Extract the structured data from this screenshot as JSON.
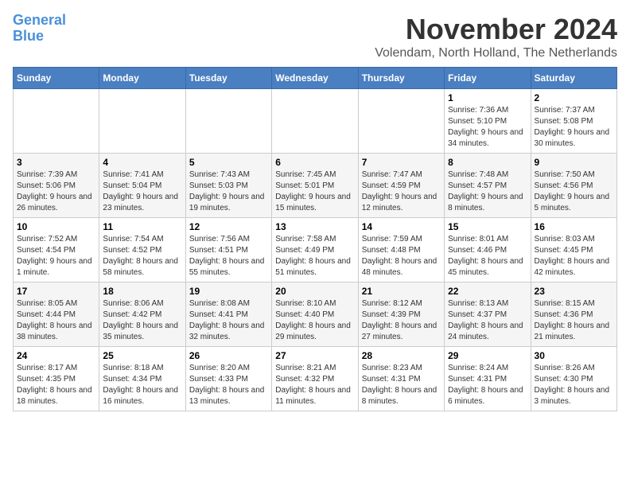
{
  "logo": {
    "line1": "General",
    "line2": "Blue"
  },
  "title": "November 2024",
  "location": "Volendam, North Holland, The Netherlands",
  "days_of_week": [
    "Sunday",
    "Monday",
    "Tuesday",
    "Wednesday",
    "Thursday",
    "Friday",
    "Saturday"
  ],
  "weeks": [
    [
      {
        "day": "",
        "info": ""
      },
      {
        "day": "",
        "info": ""
      },
      {
        "day": "",
        "info": ""
      },
      {
        "day": "",
        "info": ""
      },
      {
        "day": "",
        "info": ""
      },
      {
        "day": "1",
        "info": "Sunrise: 7:36 AM\nSunset: 5:10 PM\nDaylight: 9 hours and 34 minutes."
      },
      {
        "day": "2",
        "info": "Sunrise: 7:37 AM\nSunset: 5:08 PM\nDaylight: 9 hours and 30 minutes."
      }
    ],
    [
      {
        "day": "3",
        "info": "Sunrise: 7:39 AM\nSunset: 5:06 PM\nDaylight: 9 hours and 26 minutes."
      },
      {
        "day": "4",
        "info": "Sunrise: 7:41 AM\nSunset: 5:04 PM\nDaylight: 9 hours and 23 minutes."
      },
      {
        "day": "5",
        "info": "Sunrise: 7:43 AM\nSunset: 5:03 PM\nDaylight: 9 hours and 19 minutes."
      },
      {
        "day": "6",
        "info": "Sunrise: 7:45 AM\nSunset: 5:01 PM\nDaylight: 9 hours and 15 minutes."
      },
      {
        "day": "7",
        "info": "Sunrise: 7:47 AM\nSunset: 4:59 PM\nDaylight: 9 hours and 12 minutes."
      },
      {
        "day": "8",
        "info": "Sunrise: 7:48 AM\nSunset: 4:57 PM\nDaylight: 9 hours and 8 minutes."
      },
      {
        "day": "9",
        "info": "Sunrise: 7:50 AM\nSunset: 4:56 PM\nDaylight: 9 hours and 5 minutes."
      }
    ],
    [
      {
        "day": "10",
        "info": "Sunrise: 7:52 AM\nSunset: 4:54 PM\nDaylight: 9 hours and 1 minute."
      },
      {
        "day": "11",
        "info": "Sunrise: 7:54 AM\nSunset: 4:52 PM\nDaylight: 8 hours and 58 minutes."
      },
      {
        "day": "12",
        "info": "Sunrise: 7:56 AM\nSunset: 4:51 PM\nDaylight: 8 hours and 55 minutes."
      },
      {
        "day": "13",
        "info": "Sunrise: 7:58 AM\nSunset: 4:49 PM\nDaylight: 8 hours and 51 minutes."
      },
      {
        "day": "14",
        "info": "Sunrise: 7:59 AM\nSunset: 4:48 PM\nDaylight: 8 hours and 48 minutes."
      },
      {
        "day": "15",
        "info": "Sunrise: 8:01 AM\nSunset: 4:46 PM\nDaylight: 8 hours and 45 minutes."
      },
      {
        "day": "16",
        "info": "Sunrise: 8:03 AM\nSunset: 4:45 PM\nDaylight: 8 hours and 42 minutes."
      }
    ],
    [
      {
        "day": "17",
        "info": "Sunrise: 8:05 AM\nSunset: 4:44 PM\nDaylight: 8 hours and 38 minutes."
      },
      {
        "day": "18",
        "info": "Sunrise: 8:06 AM\nSunset: 4:42 PM\nDaylight: 8 hours and 35 minutes."
      },
      {
        "day": "19",
        "info": "Sunrise: 8:08 AM\nSunset: 4:41 PM\nDaylight: 8 hours and 32 minutes."
      },
      {
        "day": "20",
        "info": "Sunrise: 8:10 AM\nSunset: 4:40 PM\nDaylight: 8 hours and 29 minutes."
      },
      {
        "day": "21",
        "info": "Sunrise: 8:12 AM\nSunset: 4:39 PM\nDaylight: 8 hours and 27 minutes."
      },
      {
        "day": "22",
        "info": "Sunrise: 8:13 AM\nSunset: 4:37 PM\nDaylight: 8 hours and 24 minutes."
      },
      {
        "day": "23",
        "info": "Sunrise: 8:15 AM\nSunset: 4:36 PM\nDaylight: 8 hours and 21 minutes."
      }
    ],
    [
      {
        "day": "24",
        "info": "Sunrise: 8:17 AM\nSunset: 4:35 PM\nDaylight: 8 hours and 18 minutes."
      },
      {
        "day": "25",
        "info": "Sunrise: 8:18 AM\nSunset: 4:34 PM\nDaylight: 8 hours and 16 minutes."
      },
      {
        "day": "26",
        "info": "Sunrise: 8:20 AM\nSunset: 4:33 PM\nDaylight: 8 hours and 13 minutes."
      },
      {
        "day": "27",
        "info": "Sunrise: 8:21 AM\nSunset: 4:32 PM\nDaylight: 8 hours and 11 minutes."
      },
      {
        "day": "28",
        "info": "Sunrise: 8:23 AM\nSunset: 4:31 PM\nDaylight: 8 hours and 8 minutes."
      },
      {
        "day": "29",
        "info": "Sunrise: 8:24 AM\nSunset: 4:31 PM\nDaylight: 8 hours and 6 minutes."
      },
      {
        "day": "30",
        "info": "Sunrise: 8:26 AM\nSunset: 4:30 PM\nDaylight: 8 hours and 3 minutes."
      }
    ]
  ]
}
